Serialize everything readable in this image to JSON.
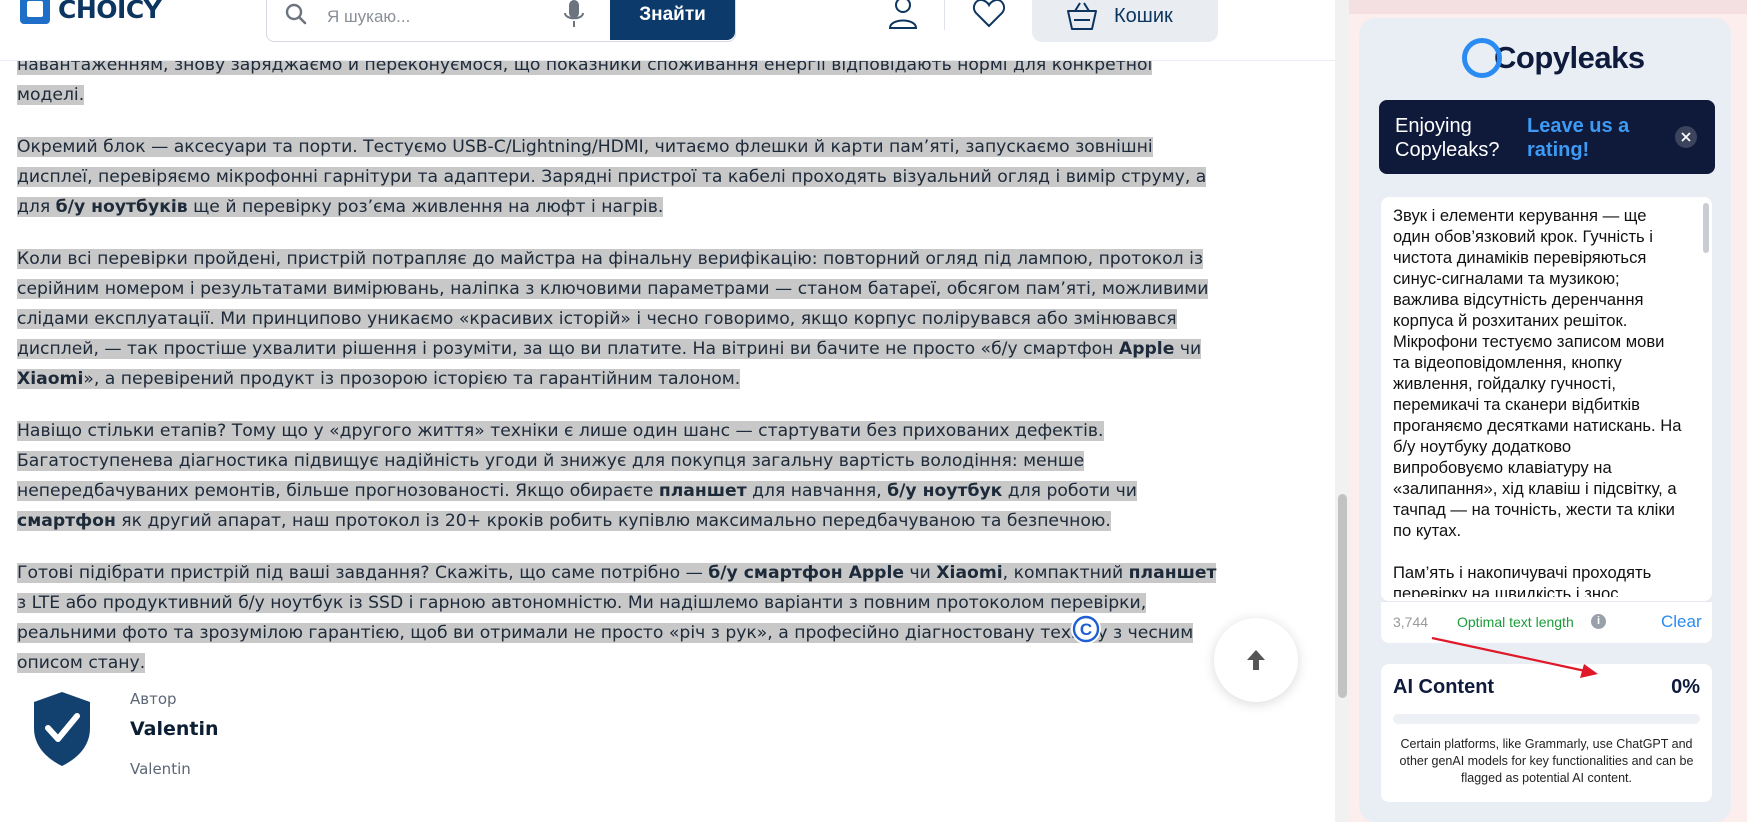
{
  "header": {
    "logo_text": "CHOICY",
    "search_placeholder": "Я шукаю...",
    "search_button": "Знайти",
    "cart_label": "Кошик"
  },
  "article": {
    "paragraphs": [
      [
        {
          "t": "навантаженням, знову заряджаємо й переконуємося, що показники споживання енергії відповідають нормі для конкретної моделі.",
          "b": false
        }
      ],
      [
        {
          "t": "Окремий блок — аксесуари та порти. Тестуємо USB-C/Lightning/HDMI, читаємо флешки й карти пам’яті, запускаємо зовнішні дисплеї, перевіряємо мікрофонні гарнітури та адаптери. Зарядні пристрої та кабелі проходять візуальний огляд і вимір струму, а для ",
          "b": false
        },
        {
          "t": "б/у ноутбуків",
          "b": true
        },
        {
          "t": " ще й перевірку роз’єма живлення на люфт і нагрів.",
          "b": false
        }
      ],
      [
        {
          "t": "Коли всі перевірки пройдені, пристрій потрапляє до майстра на фінальну верифікацію: повторний огляд під лампою, протокол із серійним номером і результатами вимірювань, наліпка з ключовими параметрами — станом батареї, обсягом пам’яті, можливими слідами експлуатації. Ми принципово уникаємо «красивих історій» і чесно говоримо, якщо корпус полірувався або змінювався дисплей, — так простіше ухвалити рішення і розуміти, за що ви платите. На вітрині ви бачите не просто «б/у смартфон ",
          "b": false
        },
        {
          "t": "Apple",
          "b": true
        },
        {
          "t": " чи ",
          "b": false
        },
        {
          "t": "Xiaomi",
          "b": true
        },
        {
          "t": "», а перевірений продукт із прозорою історією та гарантійним талоном.",
          "b": false
        }
      ],
      [
        {
          "t": "Навіщо стільки етапів? Тому що у «другого життя» техніки є лише один шанс — стартувати без прихованих дефектів. Багатоступенева діагностика підвищує надійність угоди й знижує для покупця загальну вартість володіння: менше непередбачуваних ремонтів, більше прогнозованості. Якщо обираєте ",
          "b": false
        },
        {
          "t": "планшет",
          "b": true
        },
        {
          "t": " для навчання, ",
          "b": false
        },
        {
          "t": "б/у ноутбук",
          "b": true
        },
        {
          "t": " для роботи чи ",
          "b": false
        },
        {
          "t": "смартфон",
          "b": true
        },
        {
          "t": " як другий апарат, наш протокол із 20+ кроків робить купівлю максимально передбачуваною та безпечною.",
          "b": false
        }
      ],
      [
        {
          "t": "Готові підібрати пристрій під ваші завдання? Скажіть, що саме потрібно — ",
          "b": false
        },
        {
          "t": "б/у смартфон Apple",
          "b": true
        },
        {
          "t": " чи ",
          "b": false
        },
        {
          "t": "Xiaomi",
          "b": true
        },
        {
          "t": ", компактний ",
          "b": false
        },
        {
          "t": "планшет",
          "b": true
        },
        {
          "t": " з LTE або продуктивний б/у ноутбук із SSD і гарною автономністю. Ми надішлемо варіанти з повним протоколом перевірки, реальними фото та зрозумілою гарантією, щоб ви отримали не просто «річ з рук», а професійно діагностовану техніку з чесним описом стану.",
          "b": false
        }
      ]
    ]
  },
  "author": {
    "caption": "Автор",
    "name": "Valentin",
    "sub": "Valentin"
  },
  "extension": {
    "brand": "Copyleaks",
    "banner_question": "Enjoying Copyleaks?",
    "banner_link": "Leave us a rating!",
    "input_text": "Звук і елементи керування — ще один обов’язковий крок. Гучність і чистота динаміків перевіряються синус-сигналами та музикою; важлива відсутність деренчання корпуса й розхитаних решіток. Мікрофони тестуємо записом мови та відеоповідомлення, кнопку живлення, гойдалку гучності, перемикачі та сканери відбитків проганяємо десятками натискань. На б/у ноутбуку додатково випробовуємо клавіатуру на «залипання», хід клавіш і підсвітку, а тачпад — на точність, жести та кліки по кутах.\n\nПам’ять і накопичувачі проходять перевірку на швидкість і знос",
    "char_count": "3,744",
    "text_length_status": "Optimal text length",
    "clear_label": "Clear",
    "ai_title": "AI Content",
    "ai_value": "0%",
    "ai_fraction": 0,
    "ai_note": "Certain platforms, like Grammarly, use ChatGPT and other genAI models for key functionalities and can be flagged as potential AI content."
  },
  "colors": {
    "brand_navy": "#0c3a6b",
    "copyleaks_blue": "#2a8bf2",
    "highlight_gray": "#c8c8c8",
    "status_green": "#1a9c3a",
    "arrow_red": "#e0192a"
  },
  "icons": [
    "choicy-logo-icon",
    "search-icon",
    "mic-icon",
    "user-icon",
    "heart-icon",
    "cart-icon",
    "copyleaks-c-icon",
    "arrow-up-icon",
    "shield-check-icon",
    "close-icon",
    "info-icon"
  ]
}
